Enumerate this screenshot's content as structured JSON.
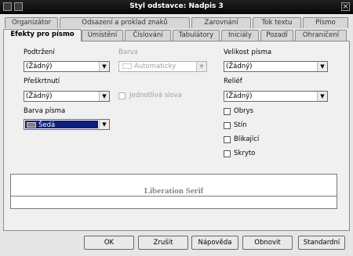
{
  "window": {
    "title": "Styl odstavce: Nadpis 3",
    "close_glyph": "×"
  },
  "tabs_row1": [
    "Organizátor",
    "Odsazení a proklad znaků",
    "Zarovnání",
    "Tok textu",
    "Písmo"
  ],
  "tabs_row2": [
    "Efekty pro písmo",
    "Umístění",
    "Číslování",
    "Tabulátory",
    "Iniciály",
    "Pozadí",
    "Ohraničení"
  ],
  "active_tab": "Efekty pro písmo",
  "form": {
    "underline": {
      "label": "Podtržení",
      "value": "(Žádný)"
    },
    "color": {
      "label": "Barva",
      "value": "Automaticky",
      "disabled": true
    },
    "font_size": {
      "label": "Velikost písma",
      "value": "(Žádný)"
    },
    "strikethrough": {
      "label": "Přeškrtnutí",
      "value": "(Žádný)"
    },
    "individual_words": {
      "label": "Jednotlivá slova",
      "disabled": true,
      "checked": false
    },
    "relief": {
      "label": "Reliéf",
      "value": "(Žádný)"
    },
    "font_color": {
      "label": "Barva písma",
      "value": "Šedá",
      "swatch": "#808080"
    },
    "checkboxes": [
      {
        "label": "Obrys",
        "checked": false
      },
      {
        "label": "Stín",
        "checked": false
      },
      {
        "label": "Blikající",
        "checked": false
      },
      {
        "label": "Skryto",
        "checked": false
      }
    ]
  },
  "preview": {
    "text": "Liberation Serif"
  },
  "buttons": {
    "ok": "OK",
    "reset": "Zrušit",
    "help": "Nápověda",
    "restore": "Obnovit",
    "standard": "Standardní"
  },
  "colors": {
    "titlebar": "#111111",
    "selection": "#0c1f7a",
    "dialog_bg": "#e6e6e6"
  }
}
